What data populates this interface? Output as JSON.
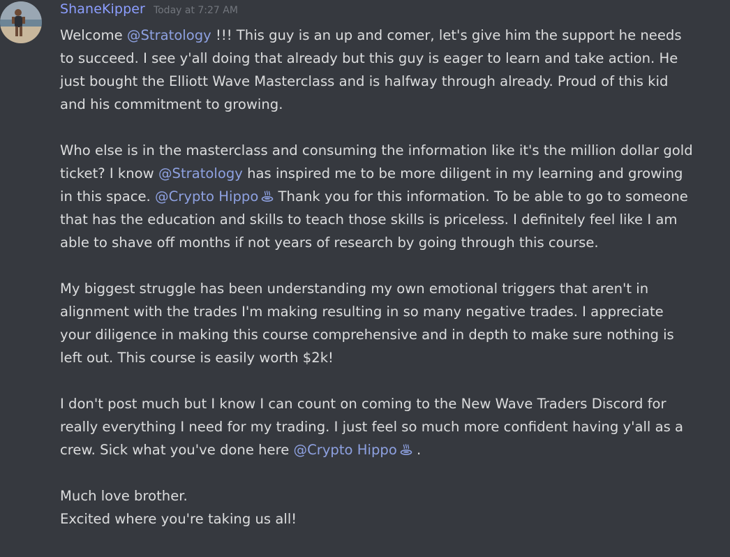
{
  "message": {
    "username": "ShaneKipper",
    "timestamp": "Today at 7:27 AM",
    "mentions": {
      "stratology": "@Stratology",
      "crypto_hippo": "@Crypto Hippo",
      "crypto_hippo_icon": "hot-springs-icon"
    },
    "paragraphs": {
      "p1": {
        "welcome": "Welcome ",
        "after_mention": " !!! This guy is an up and comer, let's give him the support he needs to succeed. I see y'all doing that already but this guy is eager to learn and take action. He just bought the Elliott Wave Masterclass and is halfway through already. Proud of this kid and his commitment to growing."
      },
      "p2": {
        "before_mention1": "Who else is in the masterclass and consuming the information like it's the million dollar gold ticket? I know ",
        "between_mentions": " has inspired me to be more diligent in my learning and growing in this space. ",
        "after_mention2": " Thank you for this information. To be able to go to someone that has the education and skills to teach those skills is priceless. I definitely feel like I am able to shave off months if not years of research by going through this course."
      },
      "p3": "My biggest struggle has been understanding my own emotional triggers that aren't in alignment with the trades I'm making resulting in so many negative trades. I appreciate your diligence in making this course comprehensive and in depth to make sure nothing is left out. This course is easily worth $2k!",
      "p4": {
        "before_mention": "I don't post much but I know I can count on coming to the New Wave Traders Discord for really everything I need for my trading. I just feel so much more confident having y'all as a crew. Sick what you've done here ",
        "after_mention": " ."
      },
      "p5": {
        "line1": "Much love brother.",
        "line2": "Excited where you're taking us all!"
      }
    }
  },
  "colors": {
    "background": "#36393f",
    "username": "#8c9eff",
    "timestamp": "#72767d",
    "text": "#dcddde",
    "mention": "#8ea1e1"
  }
}
